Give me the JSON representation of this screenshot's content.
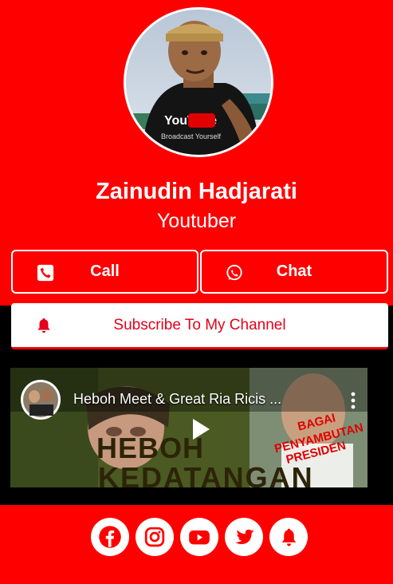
{
  "profile": {
    "name": "Zainudin Hadjarati",
    "subtitle": "Youtuber",
    "avatar_shirt_text": "YouTube",
    "avatar_shirt_sub": "Broadcast Yourself"
  },
  "buttons": {
    "call": {
      "label": "Call",
      "icon": "phone-icon"
    },
    "chat": {
      "label": "Chat",
      "icon": "whatsapp-icon"
    },
    "subscribe": {
      "label": "Subscribe To My Channel",
      "icon": "bell-icon"
    }
  },
  "video": {
    "title": "Heboh Meet & Great Ria Ricis ...",
    "overlay_text_1": "HEBOH",
    "overlay_text_2": "KEDATANGAN",
    "overlay_red_1": "BAGAI",
    "overlay_red_2": "PENYAMBUTAN",
    "overlay_red_3": "PRESIDEN"
  },
  "social": [
    {
      "name": "facebook-icon"
    },
    {
      "name": "instagram-icon"
    },
    {
      "name": "youtube-icon"
    },
    {
      "name": "twitter-icon"
    },
    {
      "name": "bell-icon"
    }
  ],
  "colors": {
    "background": "#ff0000",
    "subscribe_text": "#e3001b",
    "white": "#ffffff"
  }
}
